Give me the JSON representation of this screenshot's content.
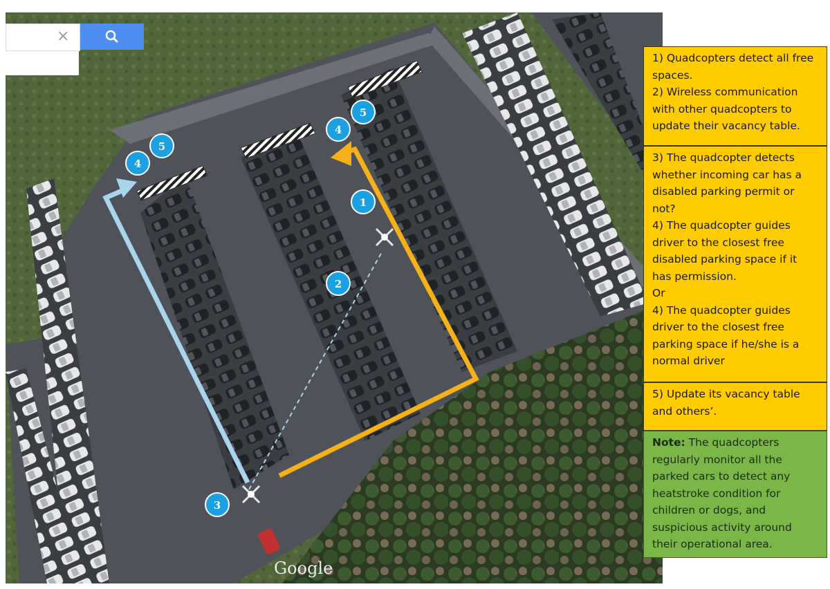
{
  "search": {
    "clear_icon": "×",
    "search_icon": "magnifier-icon"
  },
  "map": {
    "attribution": "Google",
    "markers": [
      "1",
      "2",
      "3",
      "4",
      "4",
      "5",
      "5"
    ]
  },
  "panels": {
    "step12": [
      "1) Quadcopters detect all free spaces.",
      "2) Wireless communication with other quadcopters to update their vacancy table."
    ],
    "step34": [
      "3) The quadcopter detects whether incoming car has a disabled parking permit or not?",
      "4) The quadcopter guides driver to the closest free disabled parking space if it has permission.",
      "Or",
      "4) The quadcopter guides driver to the closest free parking space if he/she is a normal driver"
    ],
    "step5": "5) Update its vacancy table and others’.",
    "note_label": "Note:",
    "note_text": " The quadcopters regularly monitor all the parked cars to detect any heatstroke condition for children or dogs, and suspicious activity around their operational area."
  },
  "colors": {
    "panel_yellow": "#ffcc00",
    "panel_green": "#7ab648",
    "route_orange": "#f5b117",
    "route_blue": "#a8d4ec",
    "marker_blue": "#1ba1e2"
  }
}
